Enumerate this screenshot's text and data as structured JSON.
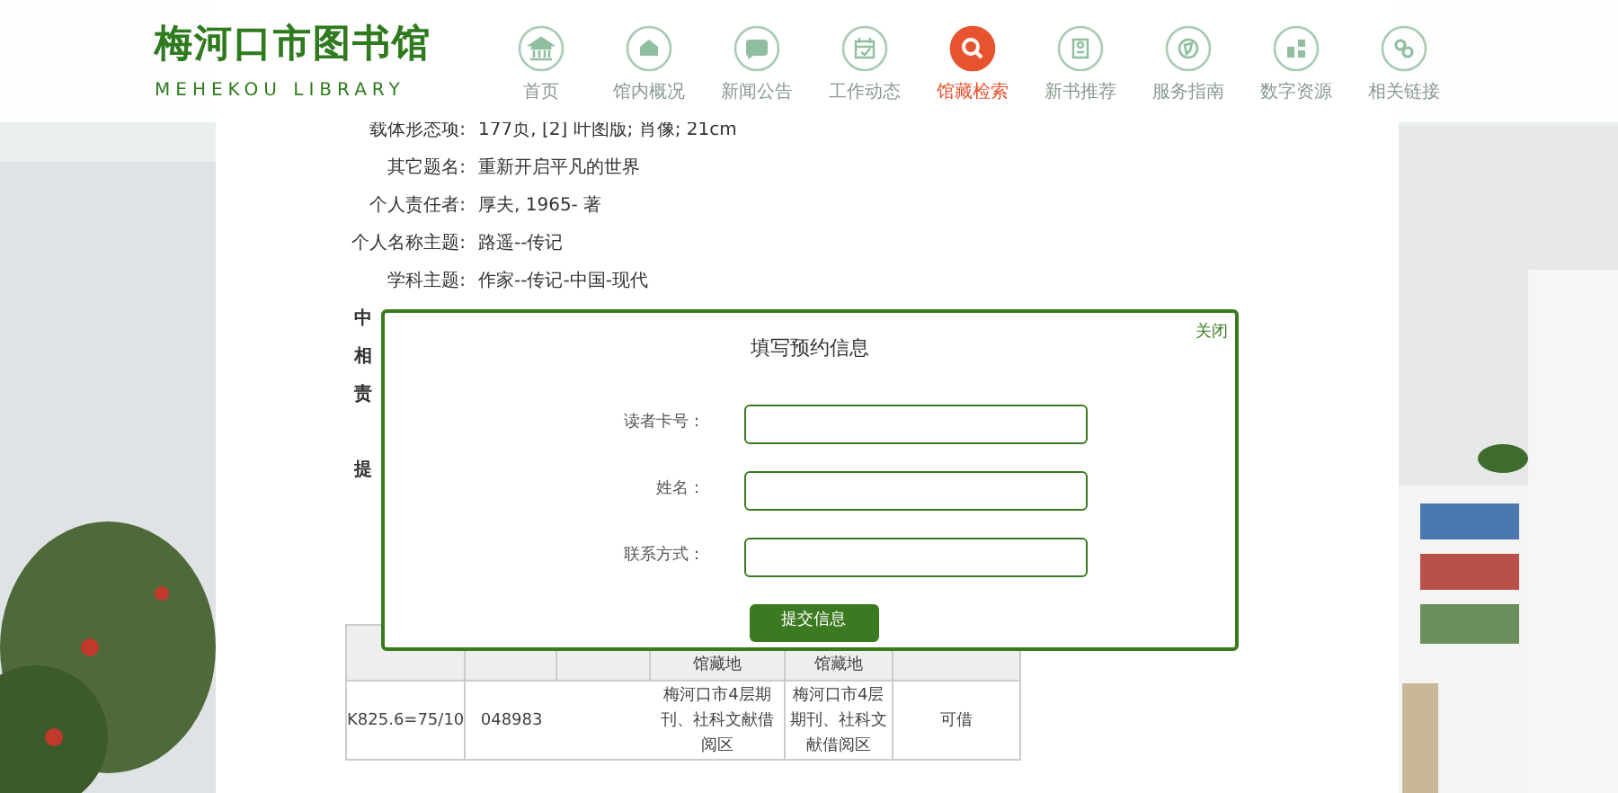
{
  "header": {
    "logo_title": "梅河口市图书馆",
    "logo_subtitle": "MEHEKOU LIBRARY"
  },
  "nav": [
    {
      "label": "首页",
      "selected": false
    },
    {
      "label": "馆内概况",
      "selected": false
    },
    {
      "label": "新闻公告",
      "selected": false
    },
    {
      "label": "工作动态",
      "selected": false
    },
    {
      "label": "馆藏检索",
      "selected": true
    },
    {
      "label": "新书推荐",
      "selected": false
    },
    {
      "label": "服务指南",
      "selected": false
    },
    {
      "label": "数字资源",
      "selected": false
    },
    {
      "label": "相关链接",
      "selected": false
    }
  ],
  "details": [
    {
      "label": "载体形态项:",
      "value": "177页, [2] 叶图版; 肖像; 21cm"
    },
    {
      "label": "其它题名:",
      "value": "重新开启平凡的世界"
    },
    {
      "label": "个人责任者:",
      "value": "厚夫, 1965- 著"
    },
    {
      "label": "个人名称主题:",
      "value": "路遥--传记"
    },
    {
      "label": "学科主题:",
      "value": "作家--传记-中国-现代"
    }
  ],
  "covered_labels": [
    "中",
    "相",
    "责",
    "提"
  ],
  "holdings": {
    "columns": [
      "",
      "",
      "",
      "馆藏地",
      "馆藏地",
      ""
    ],
    "rows": [
      [
        "K825.6=75/10",
        "048983",
        "",
        "梅河口市4层期刊、社科文献借阅区",
        "梅河口市4层期刊、社科文献借阅区",
        "可借"
      ]
    ]
  },
  "modal": {
    "title": "填写预约信息",
    "close": "关闭",
    "fields": [
      {
        "label": "读者卡号："
      },
      {
        "label": "姓名："
      },
      {
        "label": "联系方式："
      }
    ],
    "submit": "提交信息"
  }
}
